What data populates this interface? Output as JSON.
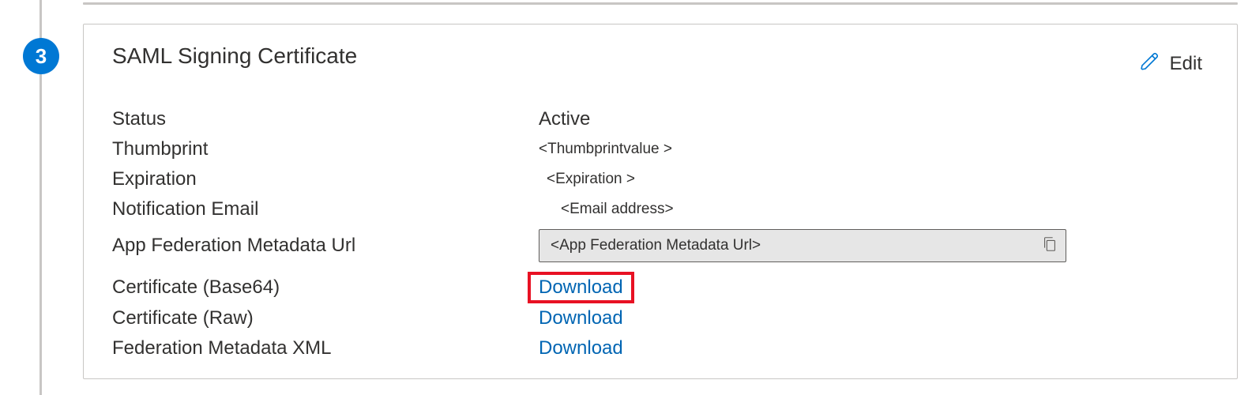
{
  "step": {
    "number": "3"
  },
  "card": {
    "title": "SAML Signing Certificate",
    "edit_label": "Edit"
  },
  "fields": {
    "status": {
      "label": "Status",
      "value": "Active"
    },
    "thumbprint": {
      "label": "Thumbprint",
      "value": "<Thumbprintvalue >"
    },
    "expiration": {
      "label": "Expiration",
      "value": "<Expiration >"
    },
    "notification_email": {
      "label": "Notification Email",
      "value": "<Email address>"
    },
    "metadata_url": {
      "label": "App Federation Metadata Url",
      "value": "<App Federation  Metadata Url>"
    },
    "cert_base64": {
      "label": "Certificate (Base64)",
      "link": "Download"
    },
    "cert_raw": {
      "label": "Certificate (Raw)",
      "link": "Download"
    },
    "fed_xml": {
      "label": "Federation Metadata XML",
      "link": "Download"
    }
  }
}
